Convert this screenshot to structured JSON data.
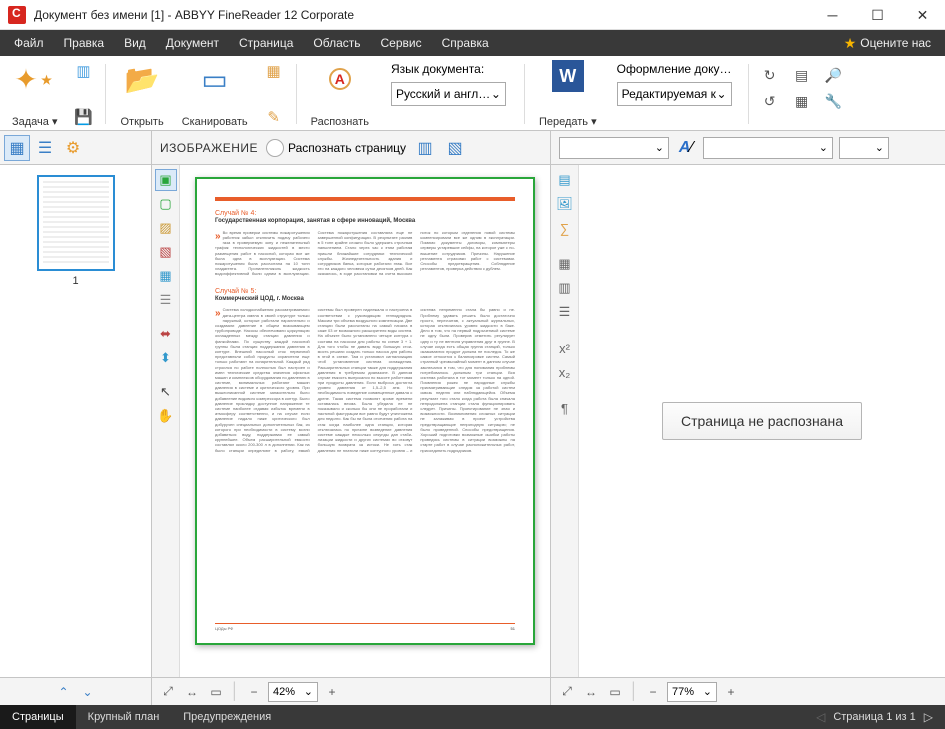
{
  "window": {
    "title": "Документ без имени [1] - ABBYY FineReader 12 Corporate"
  },
  "menu": {
    "items": [
      "Файл",
      "Правка",
      "Вид",
      "Документ",
      "Страница",
      "Область",
      "Сервис",
      "Справка"
    ],
    "rate": "Оцените нас"
  },
  "ribbon": {
    "task": "Задача",
    "open": "Открыть",
    "scan": "Сканировать",
    "recognize": "Распознать",
    "lang_label": "Язык документа:",
    "lang_value": "Русский и англ…",
    "transfer": "Передать",
    "format_label": "Оформление доку…",
    "format_value": "Редактируемая к"
  },
  "subbar": {
    "image_label": "ИЗОБРАЖЕНИЕ",
    "recognize_page": "Распознать страницу"
  },
  "thumbnails": {
    "page1": "1"
  },
  "doc": {
    "case4_num": "Случай № 4:",
    "case4_title": "Государственная корпорация, занятая в сфере инноваций, Москва",
    "case5_num": "Случай № 5:",
    "case5_title": "Коммерческий ЦОД, г. Москва",
    "footer_left": "ЦОДы РФ",
    "footer_right": "51"
  },
  "text_panel": {
    "message": "Страница не распознана"
  },
  "zoom": {
    "image": "42%",
    "text": "77%"
  },
  "status": {
    "tabs": [
      "Страницы",
      "Крупный план",
      "Предупреждения"
    ],
    "page_indicator": "Страница 1 из 1"
  }
}
